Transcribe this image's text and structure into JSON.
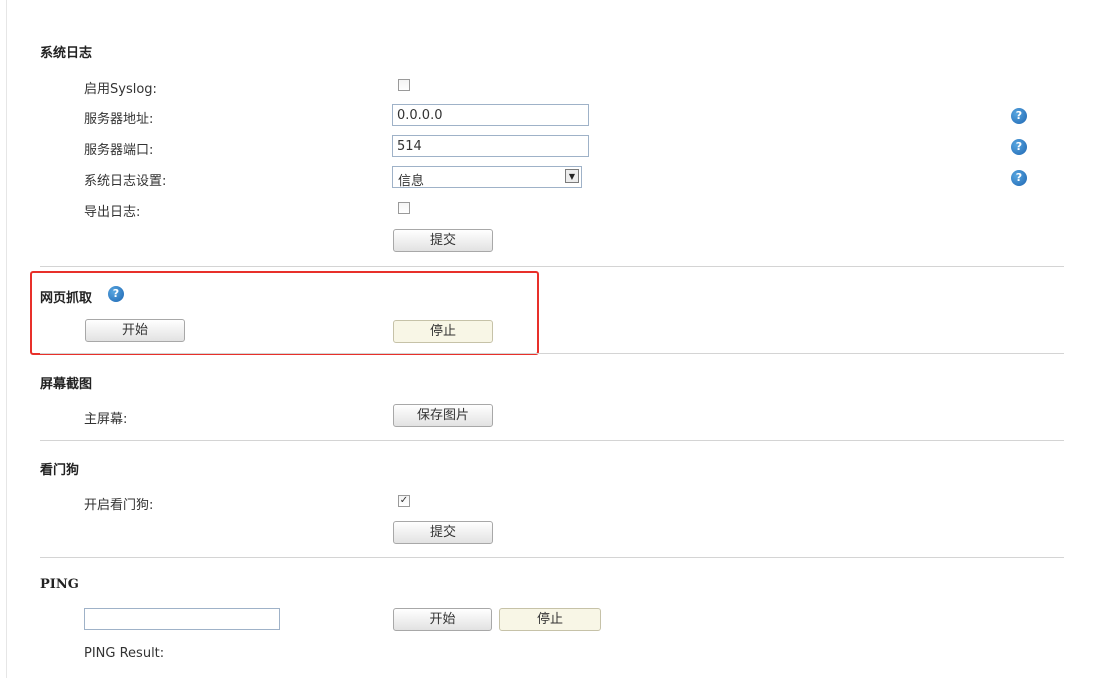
{
  "syslog": {
    "title": "系统日志",
    "enable_label": "启用Syslog:",
    "enable_checked": false,
    "server_addr_label": "服务器地址:",
    "server_addr_value": "0.0.0.0",
    "server_port_label": "服务器端口:",
    "server_port_value": "514",
    "level_label": "系统日志设置:",
    "level_value": "信息",
    "export_label": "导出日志:",
    "export_checked": false,
    "submit_label": "提交"
  },
  "web_capture": {
    "title": "网页抓取",
    "start_label": "开始",
    "stop_label": "停止",
    "highlight_color": "#e8302a"
  },
  "screenshot": {
    "title": "屏幕截图",
    "main_screen_label": "主屏幕:",
    "save_label": "保存图片"
  },
  "watchdog": {
    "title": "看门狗",
    "enable_label": "开启看门狗:",
    "enable_checked": true,
    "submit_label": "提交"
  },
  "ping": {
    "title": "PING",
    "input_value": "",
    "start_label": "开始",
    "stop_label": "停止",
    "result_label": "PING Result:"
  },
  "icons": {
    "help": "help-icon",
    "checkmark": "✓",
    "dropdown": "▼"
  },
  "colors": {
    "help_icon": "#1e66b2",
    "highlight": "#e8302a",
    "input_border": "#9fb2c8"
  }
}
